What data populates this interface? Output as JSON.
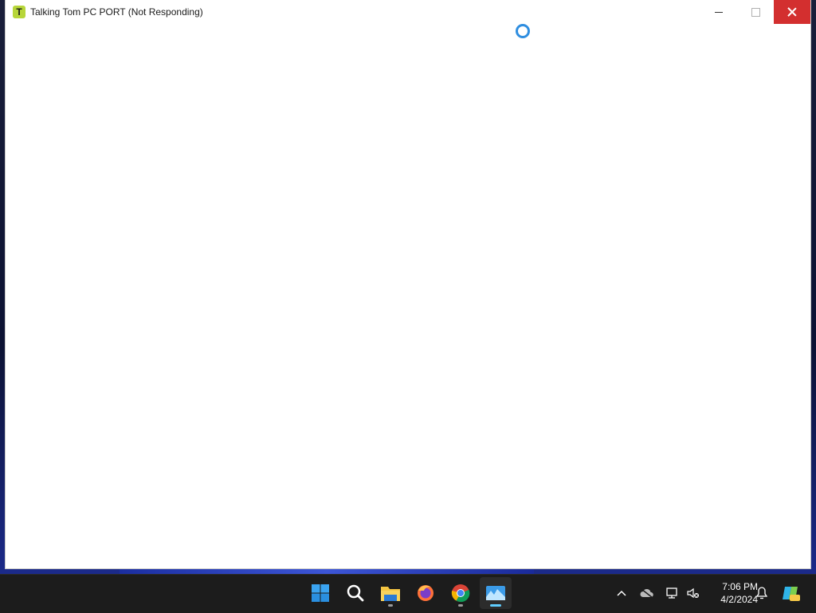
{
  "window": {
    "title": "Talking Tom PC PORT (Not Responding)",
    "app_icon_letter": "T",
    "state": "not-responding"
  },
  "taskbar": {
    "apps": [
      {
        "name": "start",
        "icon": "windows-logo-icon"
      },
      {
        "name": "search",
        "icon": "search-icon"
      },
      {
        "name": "file-explorer",
        "icon": "folder-icon"
      },
      {
        "name": "firefox",
        "icon": "firefox-icon"
      },
      {
        "name": "chrome",
        "icon": "chrome-icon"
      },
      {
        "name": "photos",
        "icon": "photos-icon",
        "active": true
      }
    ],
    "tray": {
      "time": "7:06 PM",
      "date": "4/2/2024"
    }
  },
  "colors": {
    "close_button": "#d32f2f",
    "taskbar": "#1c1c1c",
    "active_indicator": "#60cdff",
    "busy_cursor": "#2f8ee0",
    "app_icon": "#b7d63a"
  }
}
